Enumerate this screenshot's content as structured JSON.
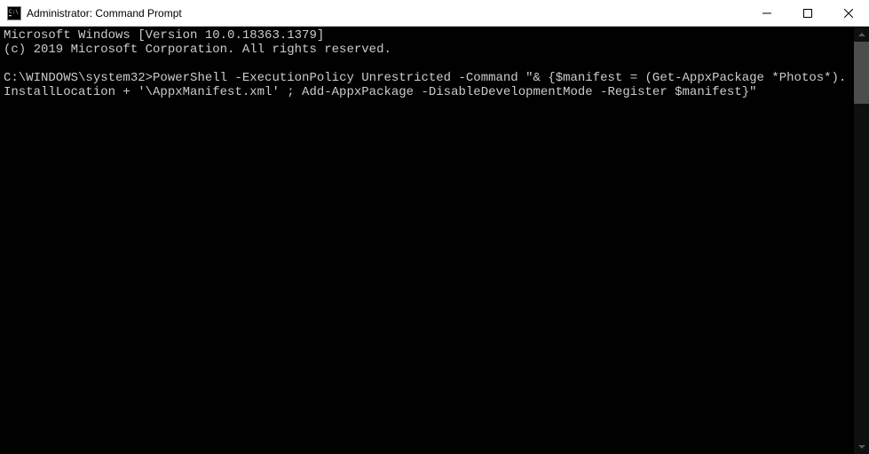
{
  "window": {
    "title": "Administrator: Command Prompt"
  },
  "console": {
    "line1": "Microsoft Windows [Version 10.0.18363.1379]",
    "line2": "(c) 2019 Microsoft Corporation. All rights reserved.",
    "blank": "",
    "prompt": "C:\\WINDOWS\\system32>",
    "command": "PowerShell -ExecutionPolicy Unrestricted -Command \"& {$manifest = (Get-AppxPackage *Photos*).InstallLocation + '\\AppxManifest.xml' ; Add-AppxPackage -DisableDevelopmentMode -Register $manifest}\""
  }
}
